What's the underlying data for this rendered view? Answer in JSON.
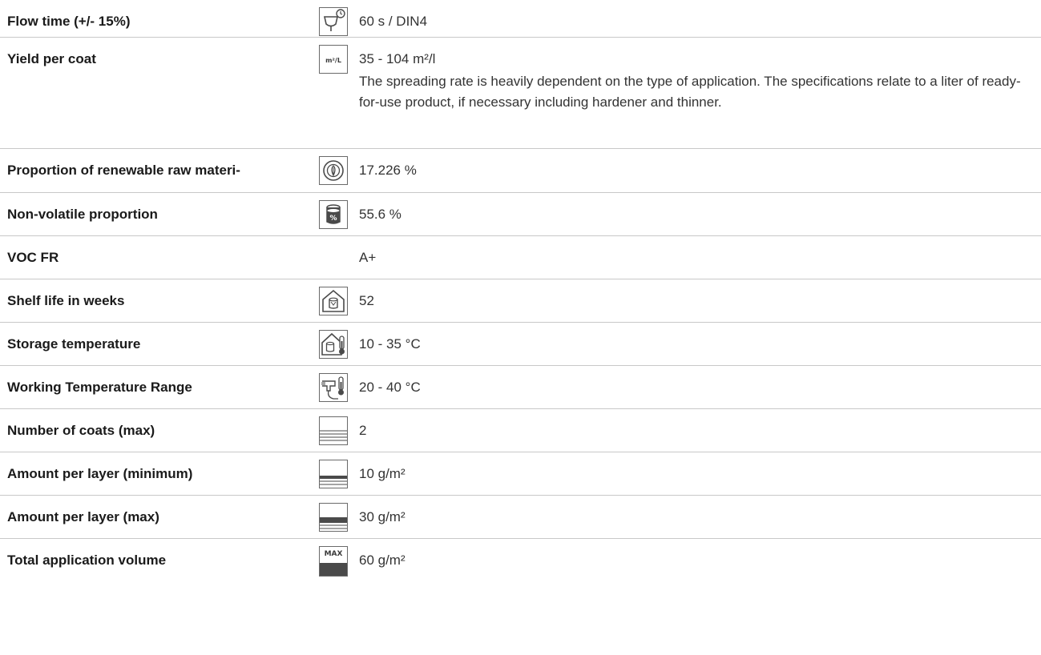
{
  "rows": [
    {
      "label": "Flow time (+/- 15%)",
      "icon": "flow-cup-timer-icon",
      "value": "60 s / DIN4",
      "note": ""
    },
    {
      "label": "Yield per coat",
      "icon": "m2-per-liter-icon",
      "value": "35 - 104 m²/l",
      "note": "The spreading rate is heavily dependent on the type of application. The specifications relate to a liter of ready-for-use product, if necessary including hardener and thinner."
    },
    {
      "label": "Proportion of renewable raw materi-",
      "icon": "renewable-leaf-icon",
      "value": "17.226 %",
      "note": ""
    },
    {
      "label": "Non-volatile proportion",
      "icon": "can-percent-icon",
      "value": "55.6 %",
      "note": ""
    },
    {
      "label": "VOC FR",
      "icon": "",
      "value": "A+",
      "note": ""
    },
    {
      "label": "Shelf life in weeks",
      "icon": "house-can-icon",
      "value": "52",
      "note": ""
    },
    {
      "label": "Storage temperature",
      "icon": "house-can-thermometer-icon",
      "value": "10 - 35 °C",
      "note": ""
    },
    {
      "label": "Working Temperature Range",
      "icon": "spray-gun-thermometer-icon",
      "value": "20 - 40 °C",
      "note": ""
    },
    {
      "label": "Number of coats (max)",
      "icon": "layers-icon",
      "value": "2",
      "note": ""
    },
    {
      "label": "Amount per layer (minimum)",
      "icon": "layers-min-icon",
      "value": "10 g/m²",
      "note": ""
    },
    {
      "label": "Amount per layer (max)",
      "icon": "layers-max-icon",
      "value": "30 g/m²",
      "note": ""
    },
    {
      "label": "Total application volume",
      "icon": "total-volume-max-icon",
      "value": "60 g/m²",
      "note": ""
    }
  ],
  "icon_text": {
    "yield": "m²/L",
    "total": "MAX"
  },
  "colors": {
    "text": "#1a1a1a",
    "icon_stroke": "#5a5a5a",
    "divider": "#c8c8c8"
  }
}
